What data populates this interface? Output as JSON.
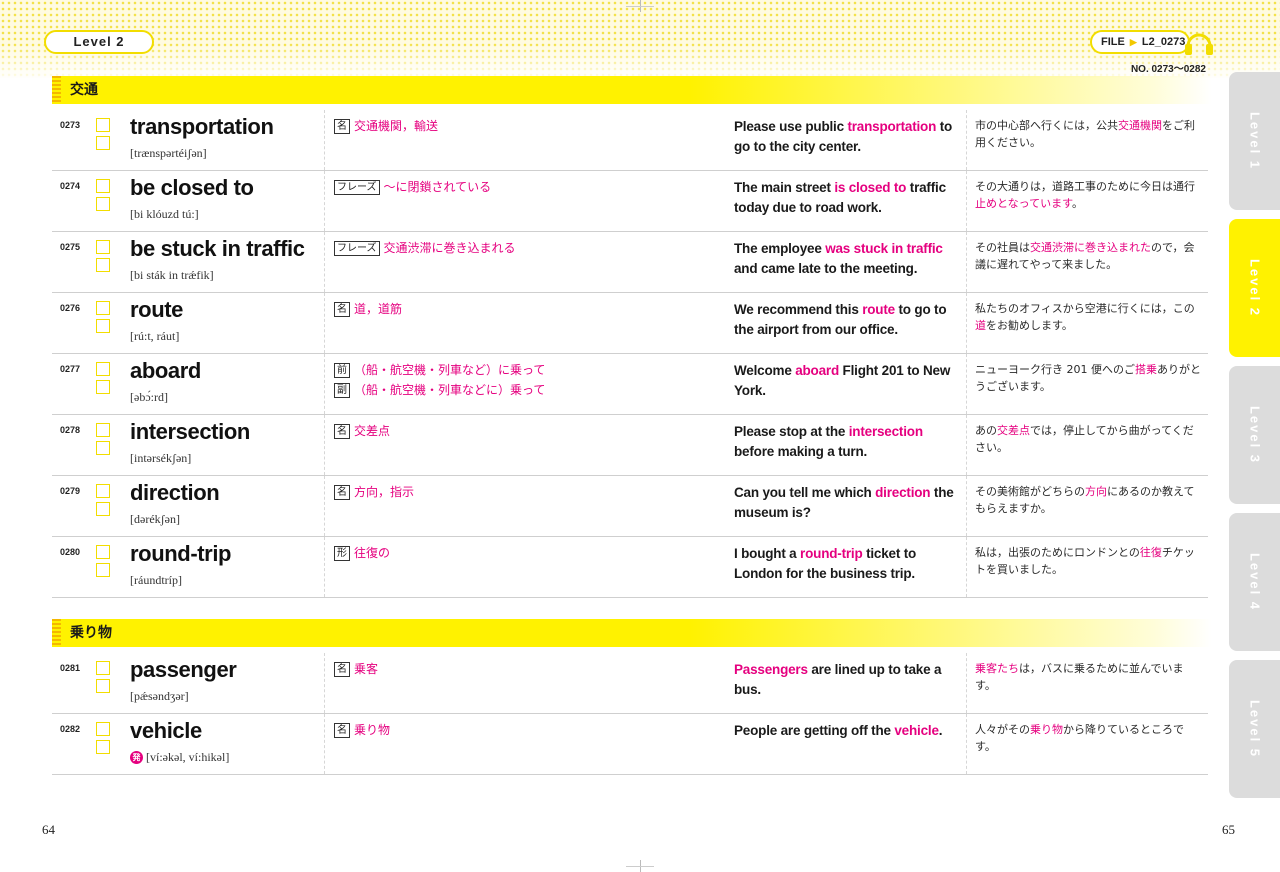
{
  "header": {
    "level_label": "Level 2",
    "file_prefix": "FILE",
    "file_arrow": "▶",
    "file_id": "L2_0273",
    "range": "NO. 0273～0282"
  },
  "sections": [
    {
      "title": "交通",
      "entries": [
        {
          "num": "0273",
          "word": "transportation",
          "pron": "[trænspərtéiʃən]",
          "pron_icon": "",
          "defs": [
            {
              "pos": "名",
              "text": "交通機関，輸送"
            }
          ],
          "example": [
            {
              "t": "Please use public ",
              "h": false
            },
            {
              "t": "transportation",
              "h": true
            },
            {
              "t": " to go to the city center.",
              "h": false
            }
          ],
          "jp": [
            {
              "t": "市の中心部へ行くには，公共",
              "h": false
            },
            {
              "t": "交通機関",
              "h": true
            },
            {
              "t": "をご利用ください。",
              "h": false
            }
          ]
        },
        {
          "num": "0274",
          "word": "be closed to",
          "pron": "[bi klóuzd tú:]",
          "pron_icon": "",
          "defs": [
            {
              "pos": "フレーズ",
              "text": "～に閉鎖されている"
            }
          ],
          "example": [
            {
              "t": "The main street ",
              "h": false
            },
            {
              "t": "is closed to",
              "h": true
            },
            {
              "t": " traffic today due to road work.",
              "h": false
            }
          ],
          "jp": [
            {
              "t": "その大通りは，道路工事のために今日は通行",
              "h": false
            },
            {
              "t": "止めとなっています",
              "h": true
            },
            {
              "t": "。",
              "h": false
            }
          ]
        },
        {
          "num": "0275",
          "word": "be stuck in traffic",
          "pron": "[bi sták in trǽfik]",
          "pron_icon": "",
          "defs": [
            {
              "pos": "フレーズ",
              "text": "交通渋滞に巻き込まれる"
            }
          ],
          "example": [
            {
              "t": "The employee ",
              "h": false
            },
            {
              "t": "was stuck in traffic",
              "h": true
            },
            {
              "t": " and came late to the meeting.",
              "h": false
            }
          ],
          "jp": [
            {
              "t": "その社員は",
              "h": false
            },
            {
              "t": "交通渋滞に巻き込まれた",
              "h": true
            },
            {
              "t": "ので，会議に遅れてやって来ました。",
              "h": false
            }
          ]
        },
        {
          "num": "0276",
          "word": "route",
          "pron": "[rú:t, ráut]",
          "pron_icon": "",
          "defs": [
            {
              "pos": "名",
              "text": "道，道筋"
            }
          ],
          "example": [
            {
              "t": "We recommend this ",
              "h": false
            },
            {
              "t": "route",
              "h": true
            },
            {
              "t": " to go to the airport from our office.",
              "h": false
            }
          ],
          "jp": [
            {
              "t": "私たちのオフィスから空港に行くには，この",
              "h": false
            },
            {
              "t": "道",
              "h": true
            },
            {
              "t": "をお勧めします。",
              "h": false
            }
          ]
        },
        {
          "num": "0277",
          "word": "aboard",
          "pron": "[əbɔ́:rd]",
          "pron_icon": "",
          "defs": [
            {
              "pos": "前",
              "text": "（船・航空機・列車など）に乗って"
            },
            {
              "pos": "副",
              "text": "（船・航空機・列車などに）乗って"
            }
          ],
          "example": [
            {
              "t": "Welcome ",
              "h": false
            },
            {
              "t": "aboard",
              "h": true
            },
            {
              "t": " Flight 201 to New York.",
              "h": false
            }
          ],
          "jp": [
            {
              "t": "ニューヨーク行き 201 便へのご",
              "h": false
            },
            {
              "t": "搭乗",
              "h": true
            },
            {
              "t": "ありがとうございます。",
              "h": false
            }
          ]
        },
        {
          "num": "0278",
          "word": "intersection",
          "pron": "[intərsékʃən]",
          "pron_icon": "",
          "defs": [
            {
              "pos": "名",
              "text": "交差点"
            }
          ],
          "example": [
            {
              "t": "Please stop at the ",
              "h": false
            },
            {
              "t": "intersection",
              "h": true
            },
            {
              "t": " before making a turn.",
              "h": false
            }
          ],
          "jp": [
            {
              "t": "あの",
              "h": false
            },
            {
              "t": "交差点",
              "h": true
            },
            {
              "t": "では，停止してから曲がってください。",
              "h": false
            }
          ]
        },
        {
          "num": "0279",
          "word": "direction",
          "pron": "[dərékʃən]",
          "pron_icon": "",
          "defs": [
            {
              "pos": "名",
              "text": "方向，指示"
            }
          ],
          "example": [
            {
              "t": "Can you tell me which ",
              "h": false
            },
            {
              "t": "direction",
              "h": true
            },
            {
              "t": " the museum is?",
              "h": false
            }
          ],
          "jp": [
            {
              "t": "その美術館がどちらの",
              "h": false
            },
            {
              "t": "方向",
              "h": true
            },
            {
              "t": "にあるのか教えてもらえますか。",
              "h": false
            }
          ]
        },
        {
          "num": "0280",
          "word": "round-trip",
          "pron": "[ráundtríp]",
          "pron_icon": "",
          "defs": [
            {
              "pos": "形",
              "text": "往復の"
            }
          ],
          "example": [
            {
              "t": "I bought a ",
              "h": false
            },
            {
              "t": "round-trip",
              "h": true
            },
            {
              "t": " ticket to London for the business trip.",
              "h": false
            }
          ],
          "jp": [
            {
              "t": "私は，出張のためにロンドンとの",
              "h": false
            },
            {
              "t": "往復",
              "h": true
            },
            {
              "t": "チケットを買いました。",
              "h": false
            }
          ]
        }
      ]
    },
    {
      "title": "乗り物",
      "entries": [
        {
          "num": "0281",
          "word": "passenger",
          "pron": "[pǽsəndʒər]",
          "pron_icon": "",
          "defs": [
            {
              "pos": "名",
              "text": "乗客"
            }
          ],
          "example": [
            {
              "t": "Passengers",
              "h": true
            },
            {
              "t": " are lined up to take a bus.",
              "h": false
            }
          ],
          "jp": [
            {
              "t": "乗客たち",
              "h": true
            },
            {
              "t": "は，バスに乗るために並んでいます。",
              "h": false
            }
          ]
        },
        {
          "num": "0282",
          "word": "vehicle",
          "pron": "[ví:əkəl, ví:hikəl]",
          "pron_icon": "発",
          "defs": [
            {
              "pos": "名",
              "text": "乗り物"
            }
          ],
          "example": [
            {
              "t": "People are getting off the ",
              "h": false
            },
            {
              "t": "vehicle",
              "h": true
            },
            {
              "t": ".",
              "h": false
            }
          ],
          "jp": [
            {
              "t": "人々がその",
              "h": false
            },
            {
              "t": "乗り物",
              "h": true
            },
            {
              "t": "から降りているところです。",
              "h": false
            }
          ]
        }
      ]
    }
  ],
  "tabs": [
    {
      "label": "Level 1",
      "active": false
    },
    {
      "label": "Level 2",
      "active": true
    },
    {
      "label": "Level 3",
      "active": false
    },
    {
      "label": "Level 4",
      "active": false
    },
    {
      "label": "Level 5",
      "active": false
    }
  ],
  "page_left": "64",
  "page_right": "65",
  "colors": {
    "accent_yellow": "#fff200",
    "highlight_pink": "#e5007f",
    "tab_gray": "#dcdcdc"
  }
}
